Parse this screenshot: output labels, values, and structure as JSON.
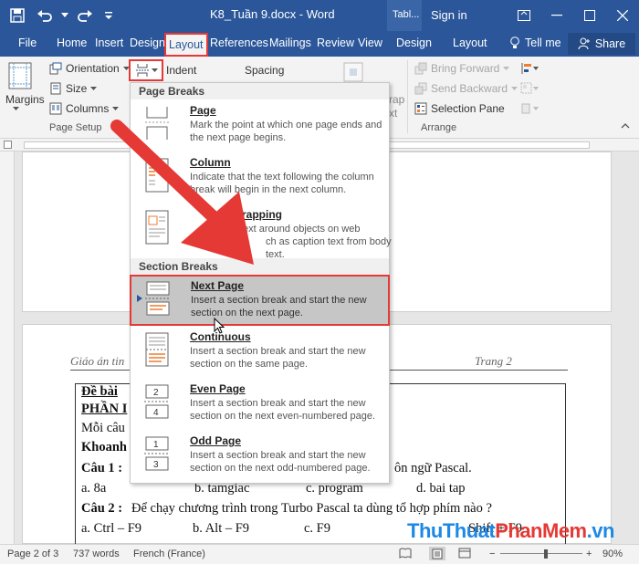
{
  "titlebar": {
    "document_title": "K8_Tuần 9.docx  -  Word",
    "context_tab": "Tabl...",
    "sign_in": "Sign in"
  },
  "tabs": {
    "file": "File",
    "home": "Home",
    "insert": "Insert",
    "design": "Design",
    "layout": "Layout",
    "references": "References",
    "mailings": "Mailings",
    "review": "Review",
    "view": "View",
    "table_design": "Design",
    "table_layout": "Layout",
    "tell_me": "Tell me",
    "share": "Share"
  },
  "ribbon": {
    "margins": "Margins",
    "orientation": "Orientation",
    "size": "Size",
    "columns": "Columns",
    "indent": "Indent",
    "spacing": "Spacing",
    "bring_forward": "Bring Forward",
    "send_backward": "Send Backward",
    "selection_pane": "Selection Pane",
    "wrap_partial": "rap",
    "text_partial": "xt",
    "page_setup_label": "Page Setup",
    "arrange_label": "Arrange"
  },
  "breaks_menu": {
    "page_breaks_heading": "Page Breaks",
    "section_breaks_heading": "Section Breaks",
    "items": [
      {
        "title": "Page",
        "desc": "Mark the point at which one page ends and the next page begins."
      },
      {
        "title": "Column",
        "desc": "Indicate that the text following the column break will begin in the next column."
      },
      {
        "title": "Text Wrapping",
        "desc": "Separate text around objects on web pages, such as caption text from body text."
      },
      {
        "title": "Next Page",
        "desc": "Insert a section break and start the new section on the next page."
      },
      {
        "title": "Continuous",
        "desc": "Insert a section break and start the new section on the same page."
      },
      {
        "title": "Even Page",
        "desc": "Insert a section break and start the new section on the next even-numbered page."
      },
      {
        "title": "Odd Page",
        "desc": "Insert a section break and start the new section on the next odd-numbered page."
      }
    ],
    "wrap_visible_title": "rapping",
    "wrap_visible_line1": "text around objects on web",
    "wrap_visible_line2": "ch as caption text from body text."
  },
  "document": {
    "header_left": "Giáo án tin",
    "header_right": "Trang 2",
    "lines": {
      "de_bai": "Đề bài",
      "de_bai_colon": ":",
      "phan": "PHẦN I",
      "moi_cau": "Mỗi câu",
      "khoanh": "Khoanh",
      "cau1_label": "Câu 1 :",
      "cau1_tail": "ôn ngữ Pascal.",
      "opt_a": "a. 8a",
      "opt_b": "b. tamgiac",
      "opt_c": "c. program",
      "opt_d": "d. bai tap",
      "cau2_label": "Câu 2 :",
      "cau2_text": "Để chạy chương trình trong Turbo Pascal ta dùng tổ hợp phím nào  ?",
      "opt2_a": "a. Ctrl – F9",
      "opt2_b": "b. Alt – F9",
      "opt2_c": "c. F9",
      "opt2_d": "Shift + F9"
    }
  },
  "statusbar": {
    "page": "Page 2 of 3",
    "words": "737 words",
    "language": "French (France)",
    "zoom": "90%"
  },
  "watermark": {
    "part1": "ThuThuat",
    "part2": "PhanMem",
    "part3": ".vn"
  },
  "colors": {
    "word_blue": "#2b579a",
    "highlight_red": "#e53935",
    "menu_highlight": "#c6c6c6"
  }
}
